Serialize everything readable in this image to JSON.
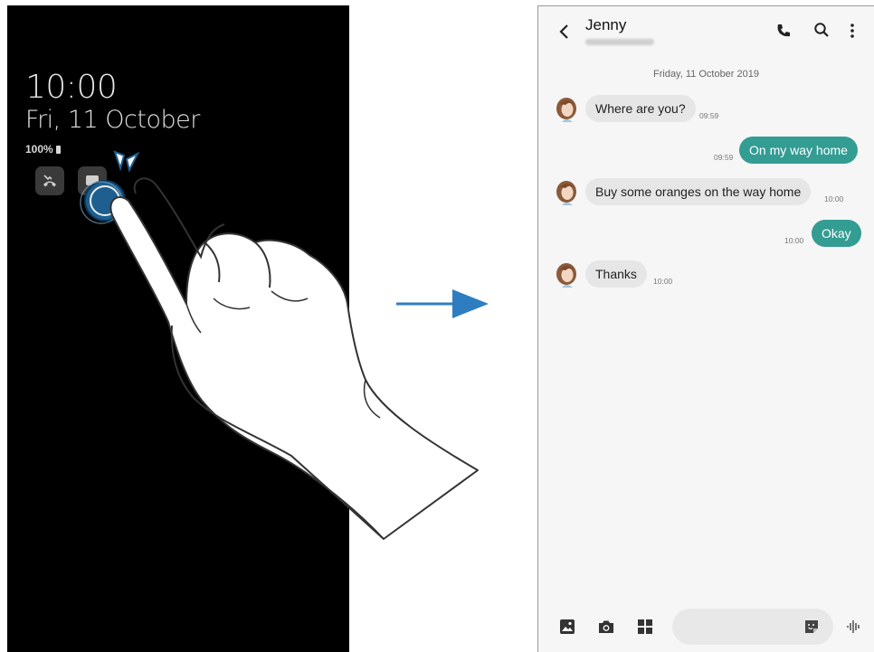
{
  "lock_screen": {
    "time": "10:00",
    "date": "Fri, 11 October",
    "battery": "100%",
    "notification_icons": [
      "missed-call-icon",
      "message-icon"
    ]
  },
  "arrow": "arrow-right-icon",
  "messages": {
    "contact_name": "Jenny",
    "day_label": "Friday, 11 October 2019",
    "conversation": [
      {
        "direction": "in",
        "text": "Where are you?",
        "time": "09:59"
      },
      {
        "direction": "out",
        "text": "On my way home",
        "time": "09:59"
      },
      {
        "direction": "in",
        "text": "Buy some oranges on the way home",
        "time": "10:00"
      },
      {
        "direction": "out",
        "text": "Okay",
        "time": "10:00"
      },
      {
        "direction": "in",
        "text": "Thanks",
        "time": "10:00"
      }
    ],
    "toolbar_icons": [
      "back-icon",
      "call-icon",
      "search-icon",
      "more-options-icon"
    ],
    "composer_icons": [
      "gallery-icon",
      "camera-icon",
      "apps-icon",
      "sticker-icon",
      "voice-icon"
    ],
    "accent_color": "#339c93"
  }
}
